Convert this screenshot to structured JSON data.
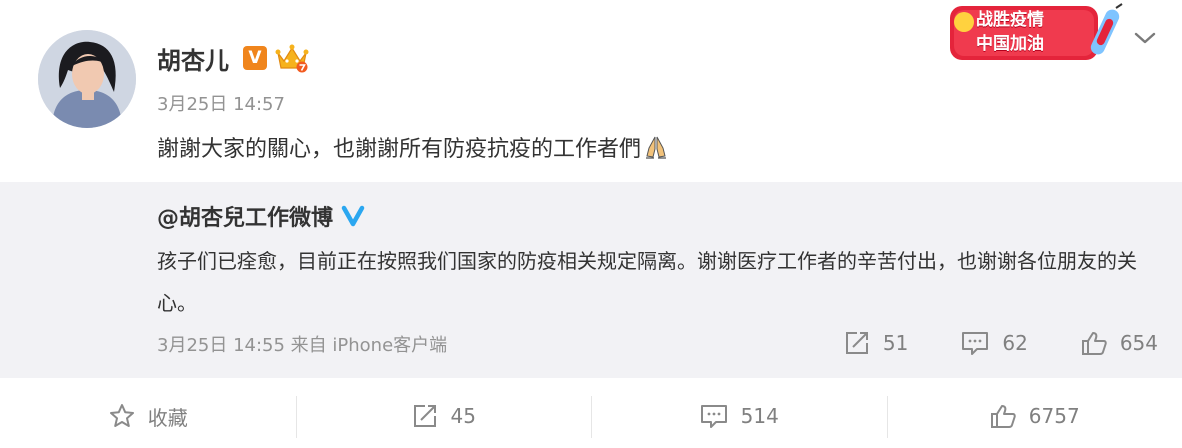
{
  "post": {
    "author": "胡杏儿",
    "vip_badge": "V",
    "time": "3月25日 14:57",
    "text": "謝謝大家的關心，也謝謝所有防疫抗疫的工作者們",
    "text_emoji": "pray-hands-icon",
    "campaign_badge": {
      "line1": "战胜疫情",
      "line2": "中国加油"
    }
  },
  "repost": {
    "author": "@胡杏兒工作微博",
    "text": "孩子们已痊愈，目前正在按照我们国家的防疫相关规定隔离。谢谢医疗工作者的辛苦付出，也谢谢各位朋友的关心。",
    "meta": "3月25日 14:55 来自 iPhone客户端",
    "forward_count": "51",
    "comment_count": "62",
    "like_count": "654"
  },
  "footer": {
    "favorite_label": "收藏",
    "forward_count": "45",
    "comment_count": "514",
    "like_count": "6757"
  },
  "colors": {
    "accent_orange": "#f0851c",
    "verified_blue": "#2ba7f0",
    "muted_text": "#939393",
    "repost_bg": "#f2f2f5",
    "campaign_red": "#e4243b"
  }
}
